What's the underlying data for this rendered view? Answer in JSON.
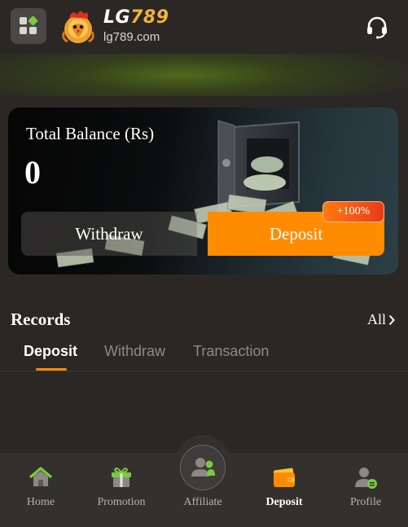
{
  "header": {
    "brand_prefix": "LG",
    "brand_number": "789",
    "domain": "lg789.com",
    "menu_icon": "grid-menu-icon",
    "support_icon": "headset-icon",
    "logo": "rooster-logo"
  },
  "balance": {
    "label": "Total Balance (Rs)",
    "value": "0",
    "withdraw_label": "Withdraw",
    "deposit_label": "Deposit",
    "bonus_badge": "+100%"
  },
  "records": {
    "title": "Records",
    "all_label": "All",
    "tabs": [
      {
        "label": "Deposit",
        "active": true
      },
      {
        "label": "Withdraw",
        "active": false
      },
      {
        "label": "Transaction",
        "active": false
      }
    ]
  },
  "bottom_nav": {
    "items": [
      {
        "label": "Home",
        "icon": "home-icon",
        "active": false
      },
      {
        "label": "Promotion",
        "icon": "gift-icon",
        "active": false
      },
      {
        "label": "Affiliate",
        "icon": "affiliate-icon",
        "active": false
      },
      {
        "label": "Deposit",
        "icon": "wallet-icon",
        "active": true
      },
      {
        "label": "Profile",
        "icon": "profile-icon",
        "active": false
      }
    ]
  },
  "colors": {
    "accent": "#ff8c00",
    "background": "#2a2725",
    "nav_background": "#33302d",
    "icon_green": "#7ac943"
  }
}
